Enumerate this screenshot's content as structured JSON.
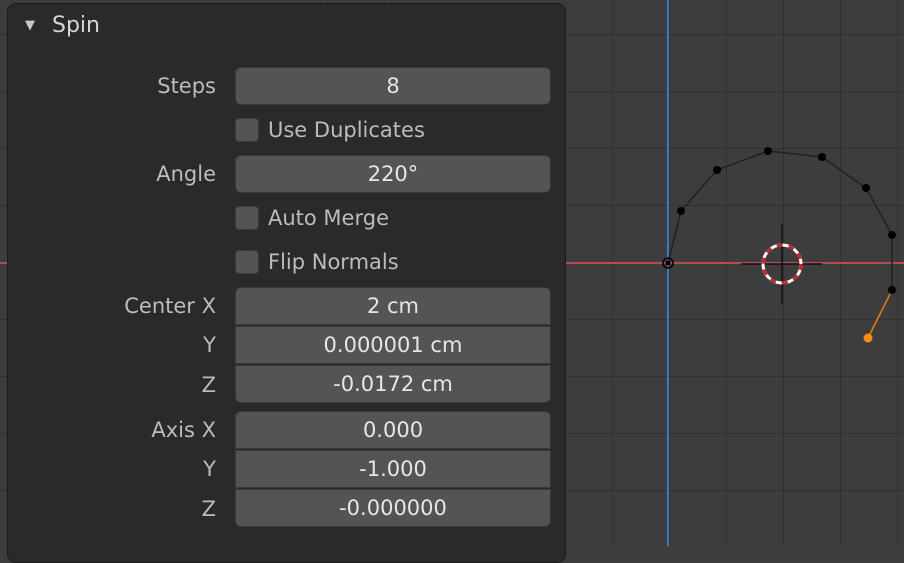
{
  "panel": {
    "title": "Spin",
    "collapse_icon": "triangle-down",
    "steps": {
      "label": "Steps",
      "value": "8"
    },
    "use_duplicates": {
      "label": "Use Duplicates",
      "checked": false
    },
    "angle": {
      "label": "Angle",
      "value": "220°"
    },
    "auto_merge": {
      "label": "Auto Merge",
      "checked": false
    },
    "flip_normals": {
      "label": "Flip Normals",
      "checked": false
    },
    "center": {
      "x": {
        "label": "Center X",
        "value": "2 cm"
      },
      "y": {
        "label": "Y",
        "value": "0.000001 cm"
      },
      "z": {
        "label": "Z",
        "value": "-0.0172 cm"
      }
    },
    "axis": {
      "x": {
        "label": "Axis X",
        "value": "0.000"
      },
      "y": {
        "label": "Y",
        "value": "-1.000"
      },
      "z": {
        "label": "Z",
        "value": "-0.000000"
      }
    }
  },
  "viewport": {
    "background_color": "#3d3d3d",
    "x_axis_color": "#b34a55",
    "z_axis_color": "#3f77c2",
    "vertex_color": "#000000",
    "active_vertex_color": "#ff8c1a",
    "cursor_icon": "3d-cursor-icon"
  }
}
